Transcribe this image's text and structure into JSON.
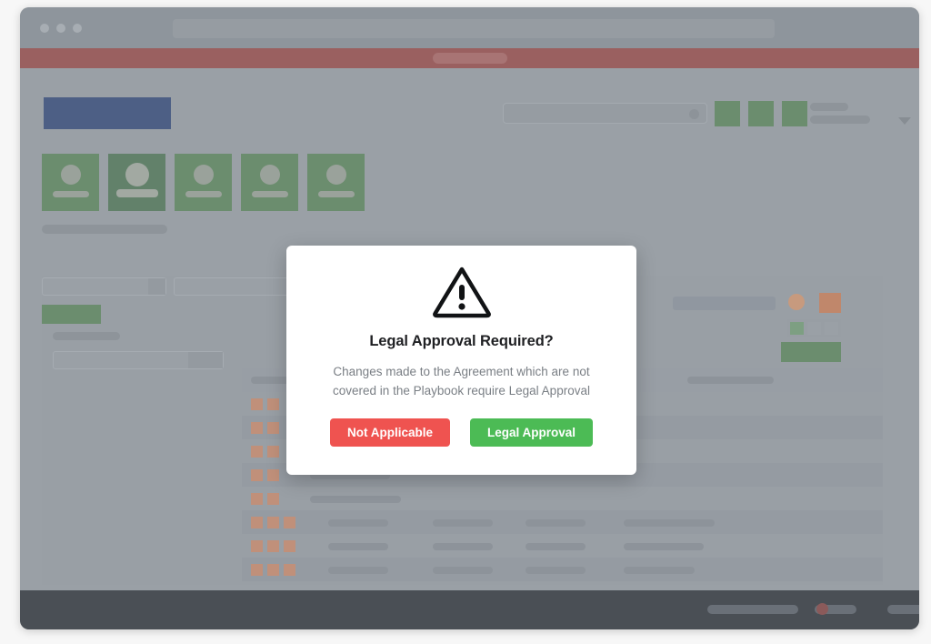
{
  "browser": {
    "traffic_lights": [
      "close-dot",
      "minimize-dot",
      "maximize-dot"
    ],
    "omnibox_placeholder": "",
    "omnibox_value": ""
  },
  "alert_strip": {
    "color": "#9a6060",
    "pill_label": ""
  },
  "header": {
    "brand_label": "",
    "brand_color": "#4d5f85",
    "search": {
      "value": "",
      "placeholder": ""
    },
    "icon_buttons": [
      {
        "name": "toolbar-icon-button-1",
        "label": ""
      },
      {
        "name": "toolbar-icon-button-2",
        "label": ""
      },
      {
        "name": "toolbar-icon-button-3",
        "label": ""
      }
    ],
    "user_menu": {
      "name_line": "",
      "role_line": ""
    }
  },
  "cards": {
    "items": [
      {
        "label": "",
        "selected": false
      },
      {
        "label": "",
        "selected": true
      },
      {
        "label": "",
        "selected": false
      },
      {
        "label": "",
        "selected": false
      },
      {
        "label": "",
        "selected": false
      }
    ],
    "caption": ""
  },
  "panel": {
    "filters": [
      {
        "name": "filter-input-1",
        "value": ""
      },
      {
        "name": "filter-input-2",
        "value": ""
      }
    ],
    "active_tab_label": "",
    "form": {
      "label": "",
      "input_value": "",
      "input_placeholder": ""
    },
    "toolbar": {
      "search_value": "",
      "circle_icon": "user-avatar-icon",
      "square_button_label": "",
      "segments": [
        {
          "label": "",
          "active": true
        },
        {
          "label": "",
          "active": false
        },
        {
          "label": "",
          "active": false
        }
      ]
    },
    "primary_action_label": "",
    "table": {
      "columns": [
        "",
        "",
        "",
        ""
      ],
      "rows": [
        {
          "badges": 2,
          "cells": [
            "",
            "",
            "",
            ""
          ]
        },
        {
          "badges": 2,
          "cells": [
            "",
            "",
            "",
            ""
          ]
        },
        {
          "badges": 2,
          "cells": [
            "",
            "",
            "",
            ""
          ]
        },
        {
          "badges": 2,
          "cells": [
            "",
            "",
            "",
            ""
          ]
        },
        {
          "badges": 2,
          "cells": [
            "",
            "",
            "",
            ""
          ]
        },
        {
          "badges": 3,
          "cells": [
            "",
            "",
            "",
            ""
          ]
        },
        {
          "badges": 3,
          "cells": [
            "",
            "",
            "",
            ""
          ]
        },
        {
          "badges": 3,
          "cells": [
            "",
            "",
            "",
            ""
          ]
        }
      ]
    }
  },
  "status_bar": {
    "items": [
      "",
      "",
      ""
    ],
    "indicator_color": "#8b5a5a"
  },
  "modal": {
    "icon": "warning-triangle-icon",
    "title": "Legal Approval Required?",
    "message": "Changes made to the Agreement which are not covered in the Playbook require Legal Approval",
    "buttons": {
      "decline_label": "Not Applicable",
      "decline_color": "#ef5350",
      "confirm_label": "Legal Approval",
      "confirm_color": "#4cbb55"
    }
  }
}
